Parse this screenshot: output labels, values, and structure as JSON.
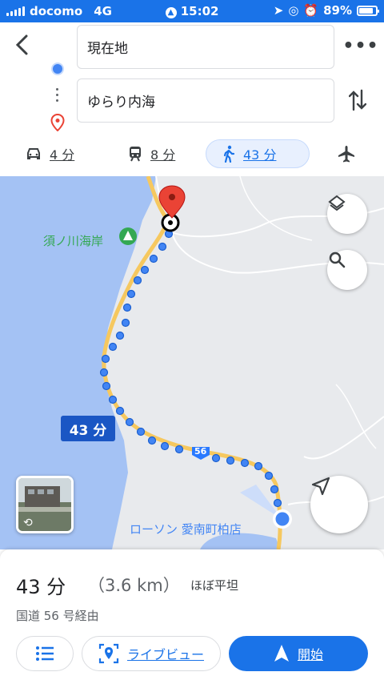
{
  "status_bar": {
    "carrier": "docomo",
    "network": "4G",
    "time": "15:02",
    "battery": "89%"
  },
  "header": {
    "origin": "現在地",
    "destination": "ゆらり内海",
    "modes": [
      {
        "icon": "car-icon",
        "label": "4 分"
      },
      {
        "icon": "train-icon",
        "label": "8 分"
      },
      {
        "icon": "walk-icon",
        "label": "43 分",
        "active": true
      },
      {
        "icon": "plane-icon",
        "label": ""
      }
    ]
  },
  "map": {
    "route_time_label": "43 分",
    "beach_label": "須ノ川海岸",
    "store_label": "ローソン 愛南町柏店",
    "road_number": "56"
  },
  "summary": {
    "time": "43 分",
    "distance": "（3.6 km）",
    "terrain": "ほぼ平坦",
    "via": "国道 56 号経由"
  },
  "actions": {
    "live_view": "ライブビュー",
    "start": "開始"
  },
  "colors": {
    "accent": "#1a73e8",
    "route_dot": "#4285f4",
    "pin_red": "#ea4335",
    "water": "#a4c2f4",
    "park_green": "#34a853"
  }
}
